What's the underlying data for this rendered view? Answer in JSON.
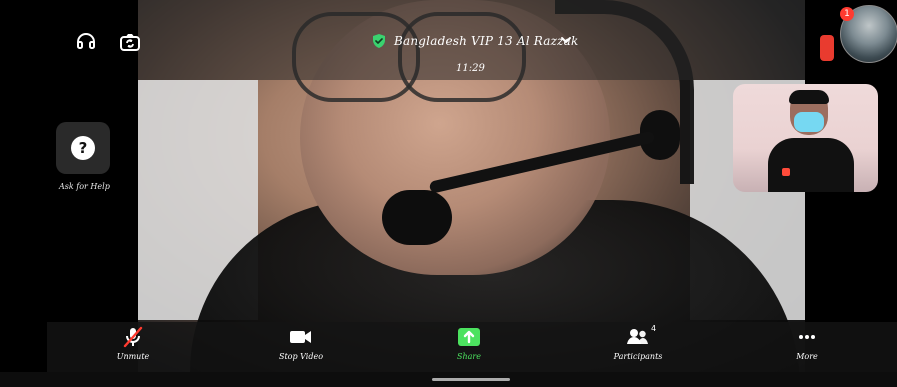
{
  "top": {
    "meeting_title": "Bangladesh VIP 13 Al Razzak",
    "time": "11:29"
  },
  "help": {
    "label": "Ask for Help",
    "icon": "question-icon"
  },
  "notification": {
    "count": "1"
  },
  "toolbar": {
    "unmute_label": "Unmute",
    "stop_video_label": "Stop Video",
    "share_label": "Share",
    "participants_label": "Participants",
    "participants_count": "4",
    "more_label": "More"
  },
  "colors": {
    "share_green": "#4ce25f",
    "notification_red": "#ff3b30",
    "mask_blue": "#76d8f2"
  }
}
